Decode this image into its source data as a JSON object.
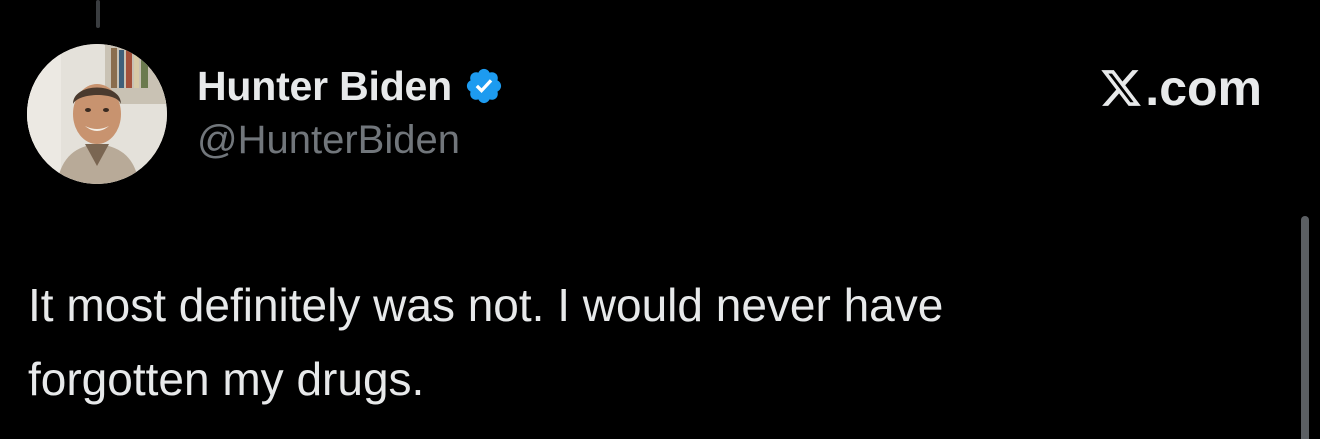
{
  "author": {
    "display_name": "Hunter Biden",
    "handle": "@HunterBiden",
    "verified": true,
    "avatar_icon": "profile-photo",
    "badge_icon": "verified-check-icon"
  },
  "brand": {
    "logo_icon": "x-logo-icon",
    "text": ".com"
  },
  "tweet": {
    "lines": [
      "It most definitely was not. I would never have",
      "forgotten my drugs."
    ]
  },
  "colors": {
    "background": "#000000",
    "text_primary": "#e7e9ea",
    "text_secondary": "#71767b",
    "verified_blue": "#1d9bf0"
  }
}
